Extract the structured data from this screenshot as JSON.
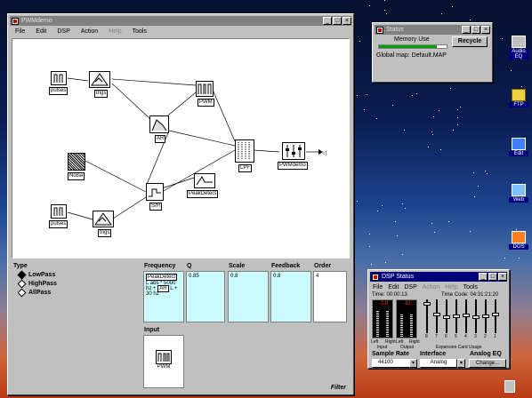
{
  "main_window": {
    "title": "PWMdemo",
    "menu": [
      "File",
      "Edit",
      "DSP",
      "Action",
      "Help",
      "Tools"
    ],
    "nodes": {
      "pulses1": "pulses",
      "trigs1": "trigs",
      "pwm": "PWM",
      "ar": "AR",
      "noise": "Noise",
      "peak": "PeakDetect",
      "sh": "S/H",
      "lpf": "LPF",
      "pwmdemo": "PWMdemo",
      "pulses2": "pulses",
      "trigs2": "trigs"
    },
    "inspector": {
      "type_label": "Type",
      "types": [
        "LowPass",
        "HighPass",
        "AllPass"
      ],
      "selected_type": "LowPass",
      "frequency_label": "Frequency",
      "frequency_tag": "PeakDetect",
      "frequency_expr_1": "L abs * 5000",
      "frequency_expr_2": "hz +",
      "frequency_expr_ar": "AR",
      "frequency_expr_3": "L +",
      "frequency_expr_4": "30 hz",
      "q_label": "Q",
      "q_value": "0.85",
      "scale_label": "Scale",
      "scale_value": "0.8",
      "feedback_label": "Feedback",
      "feedback_value": "0.8",
      "order_label": "Order",
      "order_value": "4",
      "input_label": "Input",
      "input_node": "PWM",
      "filter_tag": "Filter"
    }
  },
  "status_window": {
    "title": "Status",
    "memory_label": "Memory Use",
    "memory_fraction": 0.85,
    "recycle_button": "Recycle",
    "global_map": "Global map: Default.MAP"
  },
  "dsp_window": {
    "title": "DSP Status",
    "menu": [
      "File",
      "Edit",
      "DSP",
      "Action",
      "Help",
      "Tools"
    ],
    "time": "Time: 00:00:13",
    "timecode": "Time Code: 04:31:21:20",
    "input_peak": "-3.8",
    "output_peak": "-10.",
    "left_label": "Left",
    "right_label": "Right",
    "input_label": "Input",
    "output_label": "Output",
    "expansion_label": "Expansion Card Usage",
    "card_numbers": [
      "8",
      "7",
      "6",
      "5",
      "4",
      "3",
      "2",
      "1"
    ],
    "card_levels": [
      0.92,
      0.55,
      0.48,
      0.5,
      0.52,
      0.46,
      0.5,
      0.55
    ],
    "sample_rate_label": "Sample Rate",
    "sample_rate_value": "44100",
    "interface_label": "Interface",
    "interface_value": "Analog",
    "analog_eq_label": "Analog EQ",
    "change_button": "Change..."
  },
  "desktop_icons": [
    "Audio EQ",
    "FTP",
    "Edit",
    "Web",
    "DOS"
  ],
  "colors": {
    "titlebar_active": "#00007b",
    "field_cyan": "#ccfbff",
    "meter_red": "#ff2020"
  }
}
